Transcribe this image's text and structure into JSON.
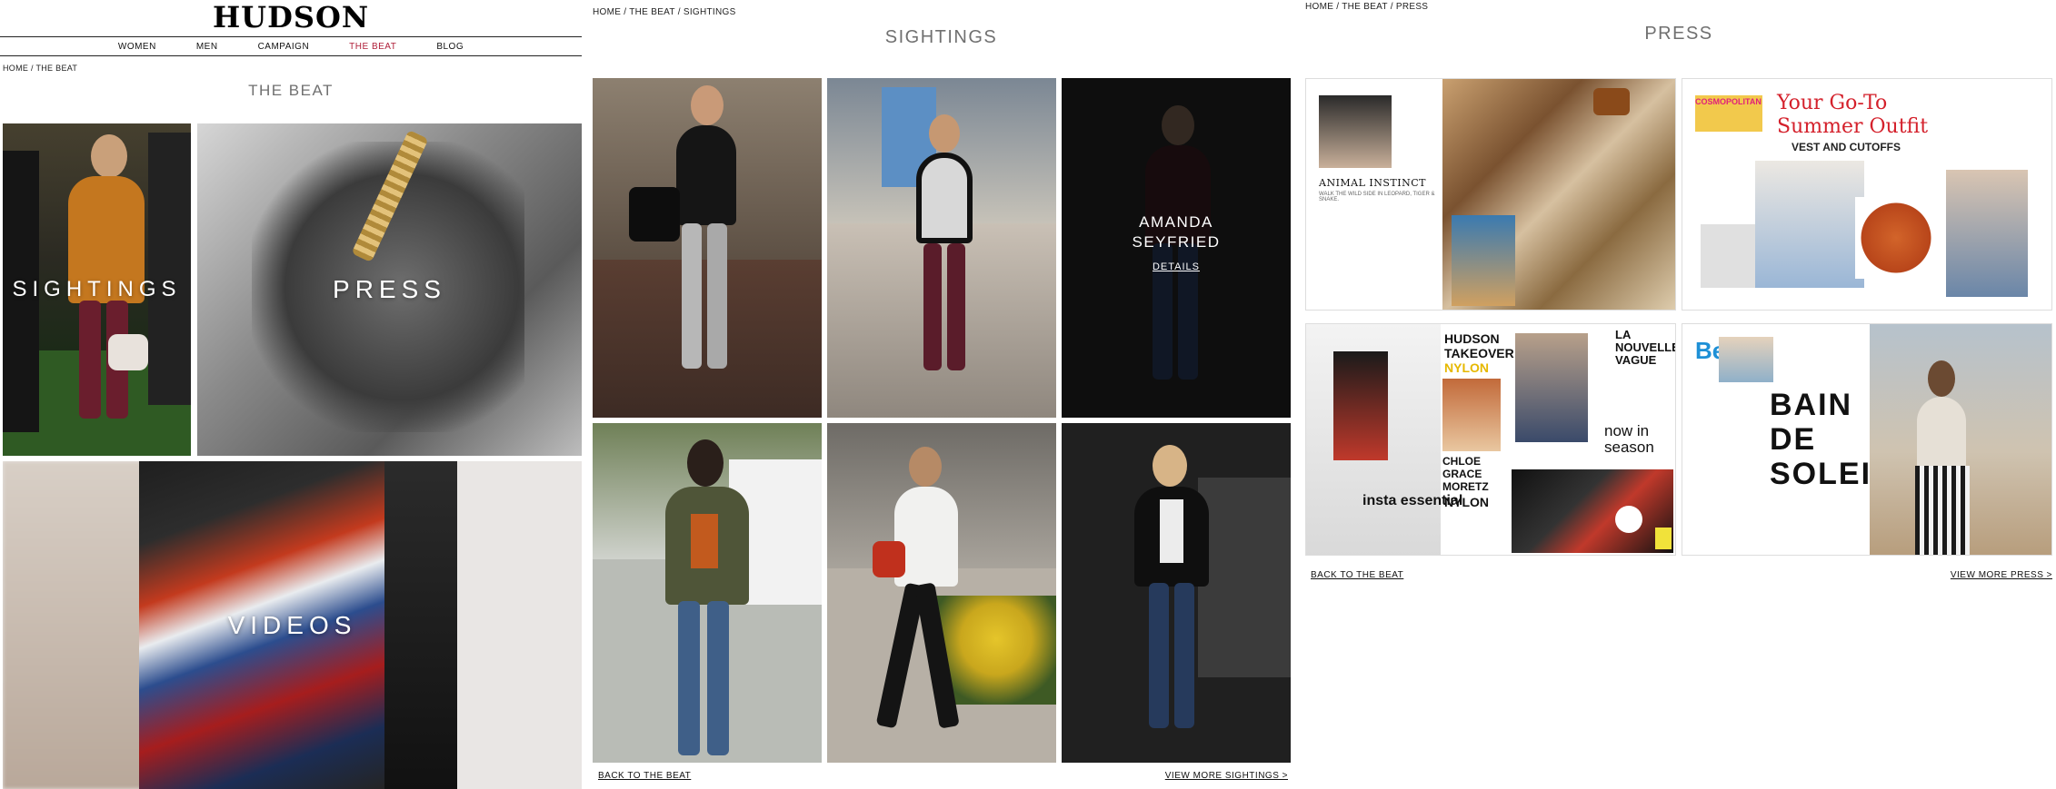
{
  "beat": {
    "logo": "HUDSON",
    "nav": [
      "WOMEN",
      "MEN",
      "CAMPAIGN",
      "THE BEAT",
      "BLOG"
    ],
    "breadcrumb": "HOME / THE BEAT",
    "title": "THE BEAT",
    "tiles": {
      "sightings": "SIGHTINGS",
      "press": "PRESS",
      "videos": "VIDEOS"
    },
    "accent": "#b0203a"
  },
  "sightings": {
    "breadcrumb": "HOME / THE BEAT / SIGHTINGS",
    "title": "SIGHTINGS",
    "featured": {
      "name_line1": "AMANDA",
      "name_line2": "SEYFRIED",
      "details": "DETAILS"
    },
    "back": "BACK TO THE BEAT",
    "more": "VIEW MORE SIGHTINGS >"
  },
  "press": {
    "breadcrumb": "HOME / THE BEAT / PRESS",
    "title": "PRESS",
    "cards": {
      "c1": {
        "headline": "ANIMAL INSTINCT",
        "sub": "WALK THE WILD SIDE IN LEOPARD, TIGER & SNAKE."
      },
      "c2": {
        "masthead": "COSMOPOLITAN",
        "headline1": "Your Go-To",
        "headline2": "Summer Outfit",
        "headline3": "VEST AND CUTOFFS"
      },
      "c3": {
        "t1": "HUDSON",
        "t2": "TAKEOVER",
        "t3": "NYLON",
        "t4": "LA",
        "t5": "NOUVELLE",
        "t6": "VAGUE",
        "t7": "now in",
        "t8": "season",
        "t9": "CHLOE",
        "t10": "GRACE",
        "t11": "MORETZ",
        "t12": "insta essential"
      },
      "c4": {
        "masthead": "Be",
        "l1": "BAIN",
        "l2": "DE",
        "l3": "SOLEIL"
      }
    },
    "back": "BACK TO THE BEAT",
    "more": "VIEW MORE PRESS >"
  }
}
